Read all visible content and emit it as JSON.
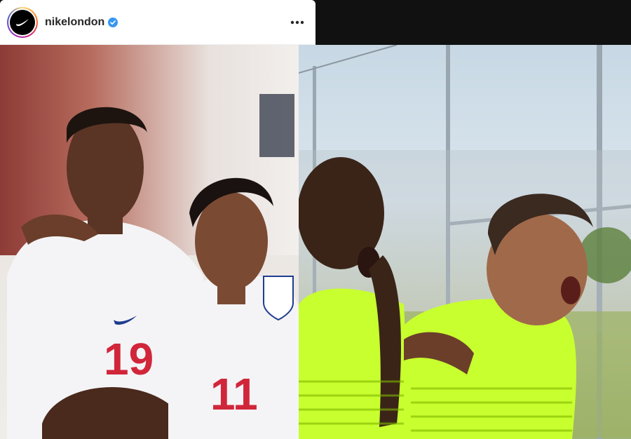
{
  "post": {
    "username": "nikelondon",
    "verified": true,
    "more_icon": "more-horizontal-icon"
  },
  "left_image": {
    "jersey_numbers": [
      "19",
      "11"
    ]
  },
  "colors": {
    "verified_blue": "#3897f0",
    "england_white": "#f4f4f6",
    "england_red": "#d1263a",
    "nike_blue": "#1f3c8f",
    "neon_kit": "#c8ff2e"
  }
}
